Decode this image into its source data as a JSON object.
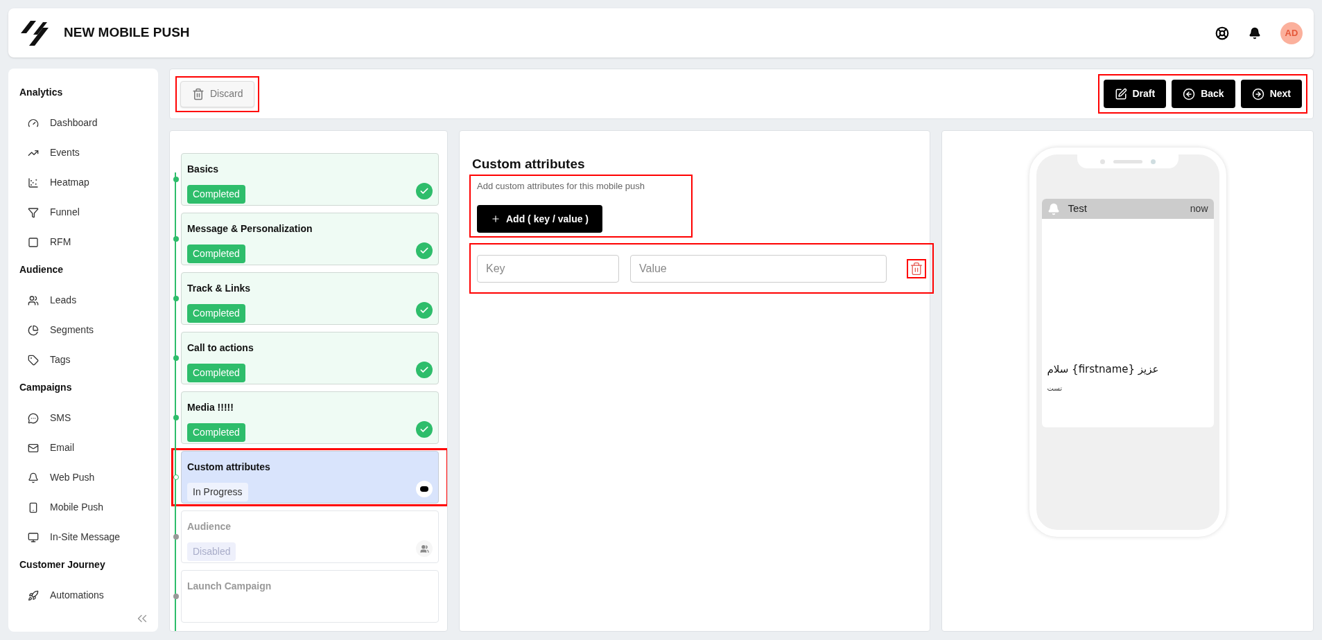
{
  "header": {
    "title": "NEW MOBILE PUSH",
    "avatar": "AD"
  },
  "sidebar": {
    "sections": [
      {
        "title": "Analytics",
        "items": [
          {
            "label": "Dashboard"
          },
          {
            "label": "Events"
          },
          {
            "label": "Heatmap"
          },
          {
            "label": "Funnel"
          },
          {
            "label": "RFM"
          }
        ]
      },
      {
        "title": "Audience",
        "items": [
          {
            "label": "Leads"
          },
          {
            "label": "Segments"
          },
          {
            "label": "Tags"
          }
        ]
      },
      {
        "title": "Campaigns",
        "items": [
          {
            "label": "SMS"
          },
          {
            "label": "Email"
          },
          {
            "label": "Web Push"
          },
          {
            "label": "Mobile Push"
          },
          {
            "label": "In-Site Message"
          }
        ]
      },
      {
        "title": "Customer Journey",
        "items": [
          {
            "label": "Automations"
          }
        ]
      }
    ]
  },
  "toolbar": {
    "discard": "Discard",
    "actions": [
      {
        "label": "Draft"
      },
      {
        "label": "Back"
      },
      {
        "label": "Next"
      }
    ]
  },
  "steps": [
    {
      "title": "Basics",
      "status": "Completed",
      "kind": "completed"
    },
    {
      "title": "Message & Personalization",
      "status": "Completed",
      "kind": "completed"
    },
    {
      "title": "Track & Links",
      "status": "Completed",
      "kind": "completed"
    },
    {
      "title": "Call to actions",
      "status": "Completed",
      "kind": "completed"
    },
    {
      "title": "Media !!!!!",
      "status": "Completed",
      "kind": "completed"
    },
    {
      "title": "Custom attributes",
      "status": "In Progress",
      "kind": "in_progress"
    },
    {
      "title": "Audience",
      "status": "Disabled",
      "kind": "disabled"
    },
    {
      "title": "Launch Campaign",
      "kind": "disabled"
    }
  ],
  "editor": {
    "title": "Custom attributes",
    "description": "Add custom attributes for this mobile push",
    "add_button": "Add ( key / value )",
    "key_placeholder": "Key",
    "value_placeholder": "Value"
  },
  "preview": {
    "app": "Test",
    "time": "now",
    "title": "عزیز {firstname} سلام",
    "body": "تست"
  }
}
